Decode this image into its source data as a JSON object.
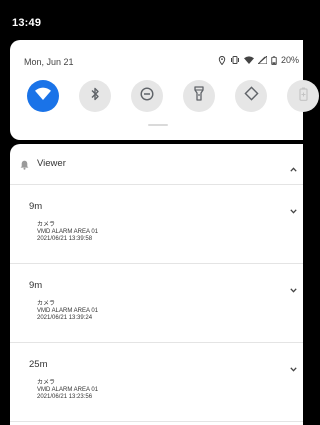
{
  "statusbar": {
    "time": "13:49"
  },
  "quick_settings": {
    "date": "Mon, Jun 21",
    "battery": "20%",
    "tiles": [
      {
        "name": "wifi",
        "icon": "wifi-icon",
        "active": true
      },
      {
        "name": "bluetooth",
        "icon": "bluetooth-icon",
        "active": false
      },
      {
        "name": "do-not-disturb",
        "icon": "do-not-disturb-icon",
        "active": false
      },
      {
        "name": "flashlight",
        "icon": "flashlight-icon",
        "active": false
      },
      {
        "name": "auto-rotate",
        "icon": "auto-rotate-icon",
        "active": false
      },
      {
        "name": "battery-saver",
        "icon": "battery-saver-icon",
        "active": false
      }
    ]
  },
  "notification_group": {
    "app_name": "Viewer",
    "items": [
      {
        "time_ago": "9m",
        "title": "カメラ",
        "message": "VMD ALARM AREA 01",
        "timestamp": "2021/06/21 13:39:58"
      },
      {
        "time_ago": "9m",
        "title": "カメラ",
        "message": "VMD ALARM AREA 01",
        "timestamp": "2021/06/21 13:39:24"
      },
      {
        "time_ago": "25m",
        "title": "カメラ",
        "message": "VMD ALARM AREA 01",
        "timestamp": "2021/06/21 13:23:56"
      }
    ]
  },
  "colors": {
    "accent": "#1a73e8",
    "tile_inactive": "#e6e6e6",
    "background": "#000000"
  }
}
